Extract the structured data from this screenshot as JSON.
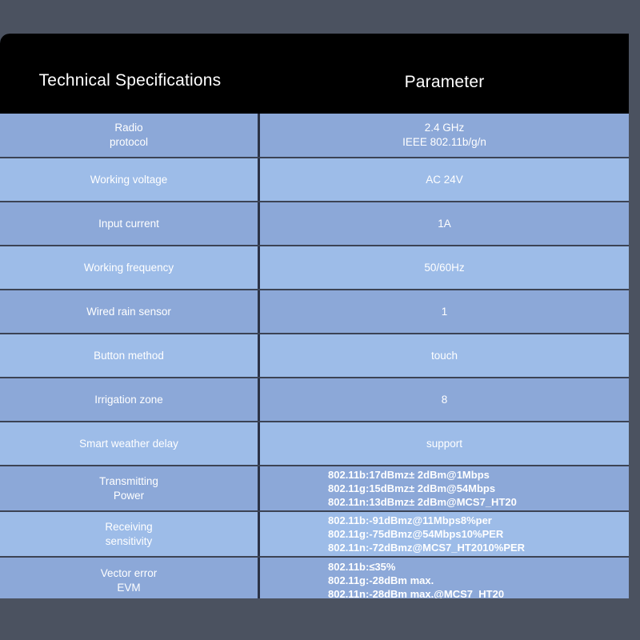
{
  "table": {
    "header": {
      "col1": "Technical Specifications",
      "col2": "Parameter"
    },
    "rows": [
      {
        "label": "Radio\nprotocol",
        "value": "2.4 GHz\nIEEE 802.11b/g/n",
        "align": "center",
        "shade": "dark"
      },
      {
        "label": "Working voltage",
        "value": "AC 24V",
        "align": "center",
        "shade": "light"
      },
      {
        "label": "Input current",
        "value": "1A",
        "align": "center",
        "shade": "dark"
      },
      {
        "label": "Working frequency",
        "value": "50/60Hz",
        "align": "center",
        "shade": "light"
      },
      {
        "label": "Wired rain sensor",
        "value": "1",
        "align": "center",
        "shade": "dark"
      },
      {
        "label": "Button method",
        "value": "touch",
        "align": "center",
        "shade": "light"
      },
      {
        "label": "Irrigation zone",
        "value": "8",
        "align": "center",
        "shade": "dark"
      },
      {
        "label": "Smart weather delay",
        "value": "support",
        "align": "center",
        "shade": "light"
      },
      {
        "label": "Transmitting\nPower",
        "value": "802.11b:17dBmz± 2dBm@1Mbps\n802.11g:15dBmz± 2dBm@54Mbps\n802.11n:13dBmz± 2dBm@MCS7_HT20",
        "align": "left",
        "shade": "dark"
      },
      {
        "label": "Receiving\nsensitivity",
        "value": "802.11b:-91dBmz@11Mbps8%per\n802.11g:-75dBmz@54Mbps10%PER\n802.11n:-72dBmz@MCS7_HT2010%PER",
        "align": "left",
        "shade": "light"
      },
      {
        "label": "Vector error\nEVM",
        "value": "802.11b:≤35%\n802.11g:-28dBm max.\n802.11n:-28dBm max.@MCS7_HT20",
        "align": "left",
        "shade": "dark"
      }
    ]
  },
  "colors": {
    "page_background": "#4b5260",
    "header_background": "#000000",
    "row_dark": "#8ca8d8",
    "row_light": "#9dbce8",
    "divider": "#2b3246",
    "text": "#ffffff"
  }
}
